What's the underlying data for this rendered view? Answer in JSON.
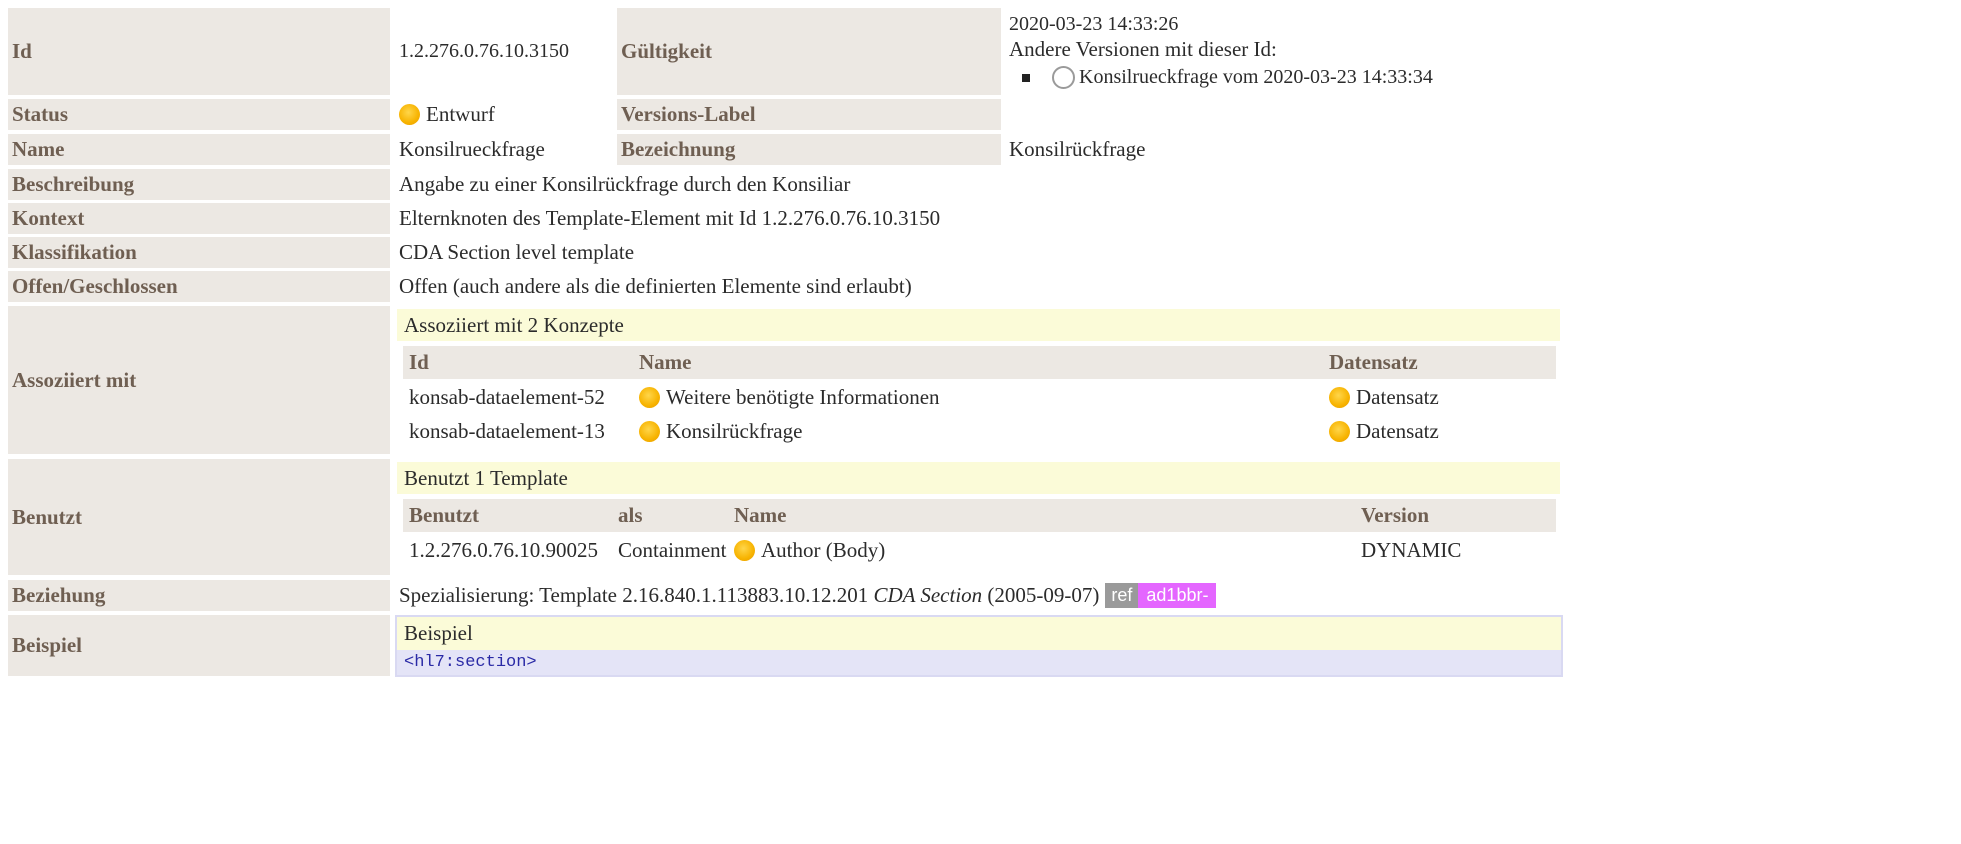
{
  "header": {
    "id_label": "Id",
    "id_value": "1.2.276.0.76.10.3150",
    "validity_label": "Gültigkeit",
    "validity_date": "2020-03-23 14:33:26",
    "other_versions_label": "Andere Versionen mit dieser Id:",
    "other_version_item": "Konsilrueckfrage vom 2020-03-23 14:33:34",
    "status_label": "Status",
    "status_value": "Entwurf",
    "version_label_label": "Versions-Label",
    "name_label": "Name",
    "name_value": "Konsilrueckfrage",
    "bezeichnung_label": "Bezeichnung",
    "bezeichnung_value": "Konsilrückfrage"
  },
  "rows": {
    "beschreibung_label": "Beschreibung",
    "beschreibung_value": "Angabe zu einer Konsilrückfrage durch den Konsiliar",
    "kontext_label": "Kontext",
    "kontext_value": "Elternknoten des Template-Element mit Id 1.2.276.0.76.10.3150",
    "klassifikation_label": "Klassifikation",
    "klassifikation_value": "CDA Section level template",
    "offen_label": "Offen/Geschlossen",
    "offen_value": "Offen (auch andere als die definierten Elemente sind erlaubt)"
  },
  "assoziiert": {
    "label": "Assoziiert mit",
    "header": "Assoziiert mit 2 Konzepte",
    "columns": [
      "Id",
      "Name",
      "Datensatz"
    ],
    "items": [
      {
        "id": "konsab-dataelement-52",
        "name": "Weitere benötigte Informationen",
        "datensatz": "Datensatz"
      },
      {
        "id": "konsab-dataelement-13",
        "name": "Konsilrückfrage",
        "datensatz": "Datensatz"
      }
    ]
  },
  "benutzt": {
    "label": "Benutzt",
    "header": "Benutzt 1 Template",
    "columns": [
      "Benutzt",
      "als",
      "Name",
      "Version"
    ],
    "items": [
      {
        "benutzt": "1.2.276.0.76.10.90025",
        "als": "Containment",
        "name": "Author (Body)",
        "version": "DYNAMIC"
      }
    ]
  },
  "beziehung": {
    "label": "Beziehung",
    "prefix": "Spezialisierung: Template 2.16.840.1.113883.10.12.201",
    "italic": "CDA Section",
    "suffix": "(2005-09-07)",
    "ref": "ref",
    "ref_id": "ad1bbr-"
  },
  "beispiel": {
    "label": "Beispiel",
    "header": "Beispiel",
    "code": "<hl7:section>"
  },
  "colors": {
    "label_bg": "#ece8e3",
    "label_text": "#6f5f52",
    "section_header_bg": "#fbfbd8",
    "code_bg": "#e4e4f7",
    "ref_id_bg": "#e466ff",
    "status_draft": "#f7b300"
  },
  "icons": [
    "status-dot-icon",
    "radio-icon",
    "bullet-icon"
  ]
}
